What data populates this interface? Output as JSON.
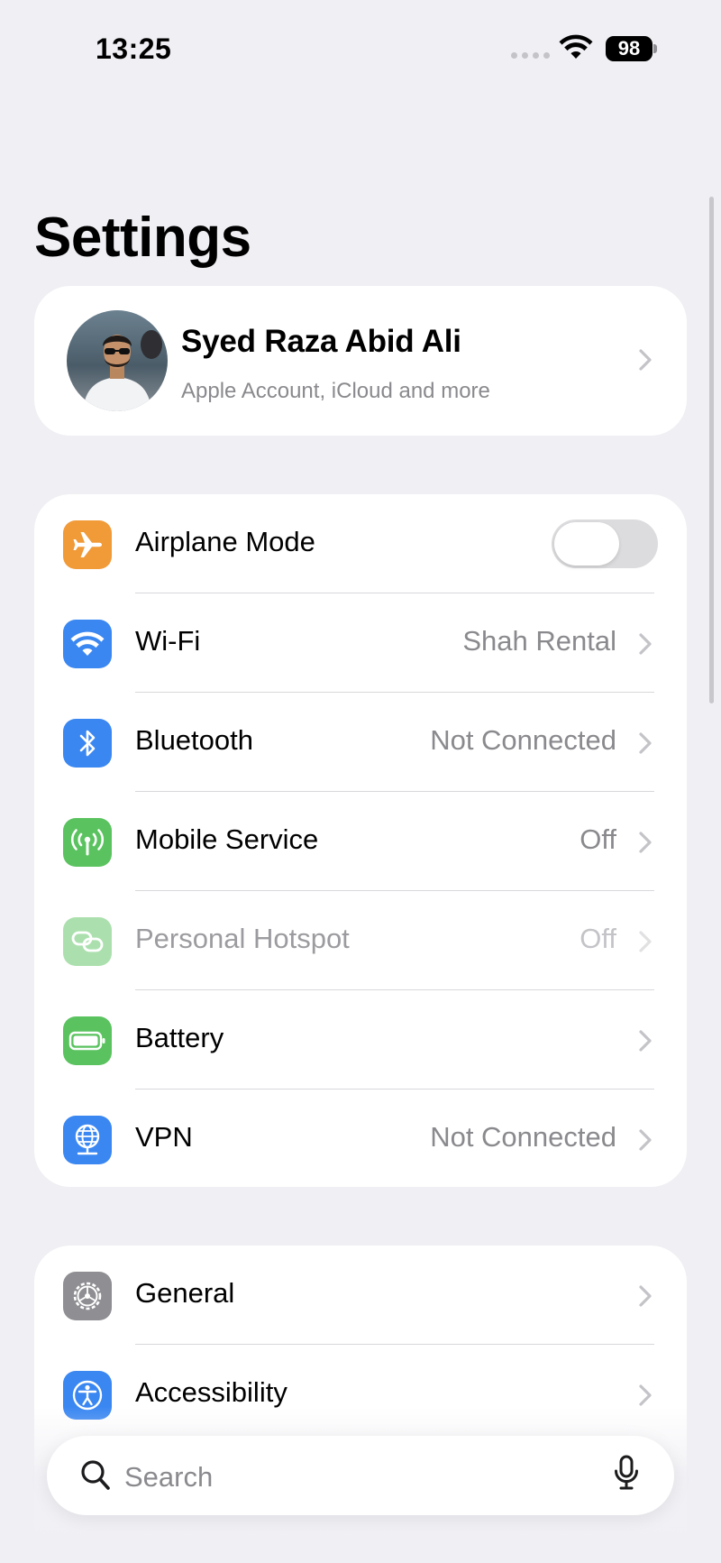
{
  "status_bar": {
    "time": "13:25",
    "battery": "98"
  },
  "header": {
    "title": "Settings"
  },
  "profile": {
    "name": "Syed Raza Abid Ali",
    "subtitle": "Apple Account, iCloud and more"
  },
  "connectivity": [
    {
      "label": "Airplane Mode",
      "value": "",
      "control": "toggle",
      "on": false,
      "icon": "airplane-icon",
      "color": "#f19a38"
    },
    {
      "label": "Wi-Fi",
      "value": "Shah Rental",
      "icon": "wifi-icon",
      "color": "#3a87f2"
    },
    {
      "label": "Bluetooth",
      "value": "Not Connected",
      "icon": "bluetooth-icon",
      "color": "#3a87f2"
    },
    {
      "label": "Mobile Service",
      "value": "Off",
      "icon": "antenna-icon",
      "color": "#5ac35f"
    },
    {
      "label": "Personal Hotspot",
      "value": "Off",
      "icon": "hotspot-icon",
      "color": "#5ac35f",
      "disabled": true
    },
    {
      "label": "Battery",
      "value": "",
      "icon": "battery-icon",
      "color": "#5ac35f"
    },
    {
      "label": "VPN",
      "value": "Not Connected",
      "icon": "vpn-globe-icon",
      "color": "#3a87f2"
    }
  ],
  "general_group": [
    {
      "label": "General",
      "icon": "gear-icon",
      "color": "#8e8e93"
    },
    {
      "label": "Accessibility",
      "icon": "accessibility-icon",
      "color": "#3a87f2"
    }
  ],
  "search": {
    "placeholder": "Search"
  }
}
